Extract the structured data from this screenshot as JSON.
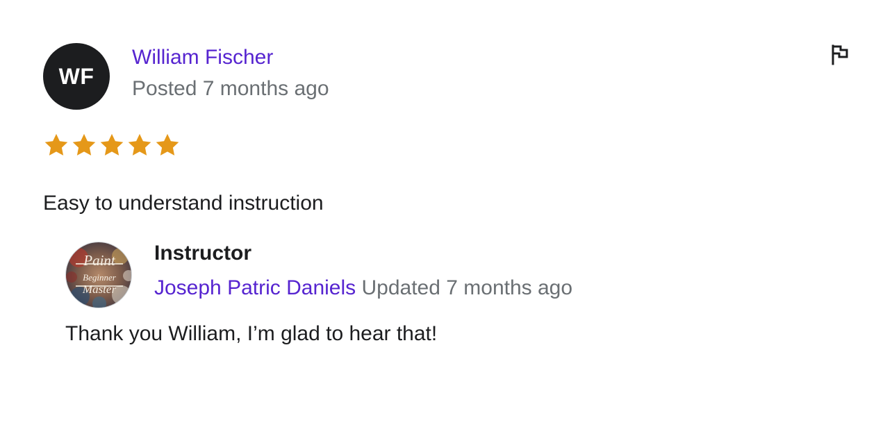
{
  "review": {
    "reviewer_initials": "WF",
    "reviewer_name": "William Fischer",
    "posted": "Posted 7 months ago",
    "rating": 5,
    "rating_max": 5,
    "text": "Easy to understand instruction",
    "flag_icon": "flag-icon",
    "star_color": "#e59819"
  },
  "response": {
    "role": "Instructor",
    "name": "Joseph Patric Daniels",
    "updated": "Updated 7 months ago",
    "text": "Thank you William, I’m glad to hear that!",
    "avatar_lettering": [
      "Paint",
      "Beginner",
      "Master"
    ]
  },
  "colors": {
    "link": "#5624d0",
    "muted": "#6a6f73",
    "text": "#1c1d1f"
  }
}
